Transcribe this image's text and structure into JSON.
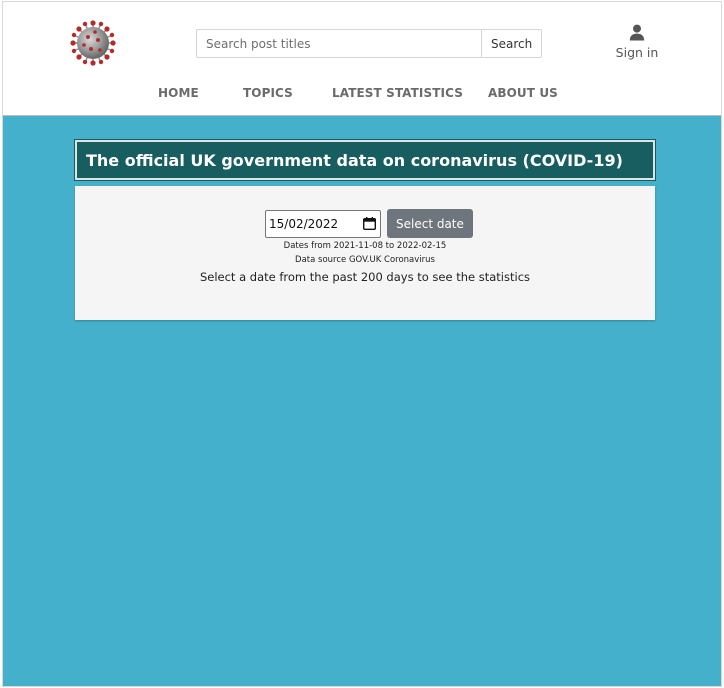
{
  "header": {
    "search": {
      "placeholder": "Search post titles",
      "value": "",
      "button_label": "Search"
    },
    "signin": {
      "label": "Sign in",
      "icon": "user-icon"
    },
    "logo": {
      "icon": "coronavirus-logo"
    }
  },
  "nav": {
    "items": [
      {
        "label": "HOME"
      },
      {
        "label": "TOPICS"
      },
      {
        "label": "LATEST STATISTICS"
      },
      {
        "label": "ABOUT US"
      }
    ]
  },
  "main": {
    "title": "The official UK government data on coronavirus (COVID-19)",
    "date_input": {
      "value": "15/02/2022",
      "icon": "calendar-icon"
    },
    "select_date_label": "Select date",
    "range_note": "Dates from 2021-11-08 to 2022-02-15",
    "source_note": "Data source GOV.UK Coronavirus",
    "instruction": "Select a date from the past 200 days to see the statistics"
  },
  "colors": {
    "page_background": "#45b0cb",
    "title_background": "#185e60",
    "button_background": "#6e757c",
    "panel_background": "#f5f5f5"
  }
}
